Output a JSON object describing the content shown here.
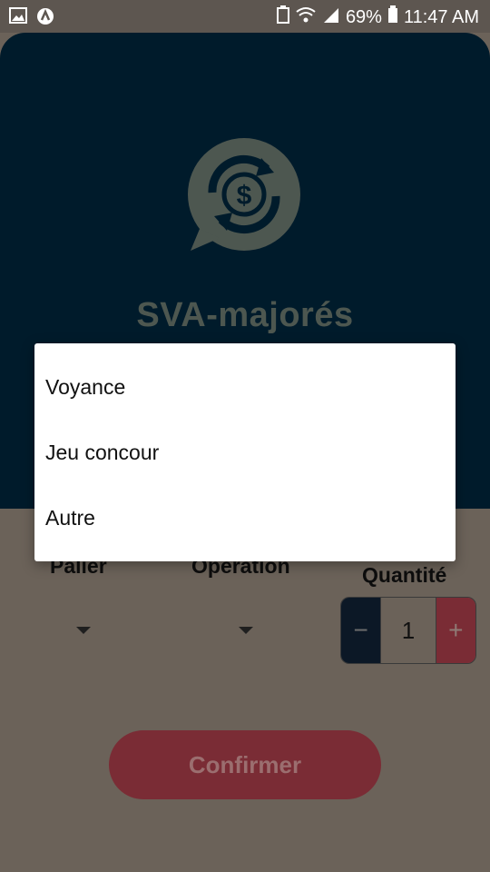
{
  "status_bar": {
    "battery": "69%",
    "time": "11:47 AM"
  },
  "app": {
    "title": "SVA-majorés"
  },
  "form": {
    "palier_label": "Palier",
    "operation_label": "Operation",
    "quantite_label": "Quantité",
    "quantity_value": "1",
    "minus_label": "−",
    "plus_label": "+",
    "confirm_label": "Confirmer"
  },
  "dropdown": {
    "items": [
      "Voyance",
      "Jeu concour",
      "Autre"
    ]
  },
  "colors": {
    "hero": "#001b2b",
    "accent": "#7a2c35",
    "overlay_bg": "#6b6259"
  }
}
